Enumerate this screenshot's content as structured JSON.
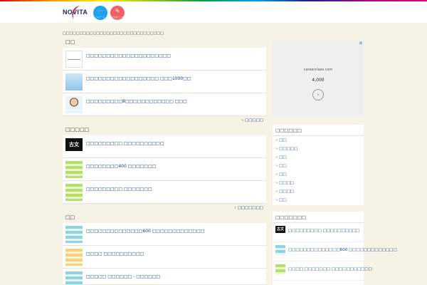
{
  "header": {
    "logo": "NOVITA",
    "sns": [
      {
        "name": "twitter",
        "label": "ツイート",
        "icon": "twitter-bird-icon"
      },
      {
        "name": "hatena",
        "label": "はてなブックマーク",
        "icon": "bookmark-icon"
      }
    ]
  },
  "breadcrumb": "□□□□□□□□□□□□□□□□□□□□□□□□□□□□□□",
  "sections": [
    {
      "title": "□□",
      "items": [
        {
          "title": "□□□□□□□□□□□□□□□□□□□□□",
          "thumb": "t-line"
        },
        {
          "title": "□□□□□□□□□□□□□□□□□□ □□□1000□□",
          "thumb": "t-blue"
        },
        {
          "title": "□□□□□□□□□8□□□□□□□□□□□□ □□□",
          "thumb": "t-person"
        }
      ],
      "more": "□□□□□"
    },
    {
      "title": "□□□□□",
      "items": [
        {
          "title": "□□□□□□□□□ □□□□□□□□□□",
          "thumb": "t-black",
          "thumb_text": "古文"
        },
        {
          "title": "□□□□□□□□400 □□□□□□□",
          "thumb": "t-green"
        },
        {
          "title": "□□□□□□□□□ □□□□□□□",
          "thumb": "t-green"
        }
      ],
      "more": "□□□□□□□"
    },
    {
      "title": "□□",
      "items": [
        {
          "title": "□□□□□□□□□□□□□□600 □□□□□□□□□□□□□",
          "thumb": "t-cyan"
        },
        {
          "title": "□□□□ □□□□□□□□□□",
          "thumb": "t-yellow"
        },
        {
          "title": "□□□□□ □□□□□□ - □□□□□□",
          "thumb": "t-cyan"
        }
      ]
    }
  ],
  "ad": {
    "close": "⊠",
    "url": "careerclass.com",
    "count": "4,000",
    "arrow": "›"
  },
  "sidebar": {
    "categories_title": "□□□□□□",
    "categories": [
      "□□",
      "□□□□□",
      "□□",
      "□□",
      "□□",
      "□□□□",
      "□□□□",
      "□□"
    ],
    "ranking_title": "□□□□□□□",
    "ranking": [
      {
        "title": "□□□□□□□□□ □□□□□□□□□□",
        "thumb": "t-black",
        "thumb_text": "古文"
      },
      {
        "title": "□□□□□□□□□□□□□□600 □□□□□□□□□□□□□",
        "thumb": "t-cyan"
      },
      {
        "title": "□□□□ □□□□□□□ □□□□□□□□□□□",
        "thumb": "t-green"
      }
    ]
  },
  "colors": {
    "background": "#f6f3e6",
    "link": "#0b3d7a",
    "twitter": "#1da1f2",
    "hatena": "#f06060"
  }
}
